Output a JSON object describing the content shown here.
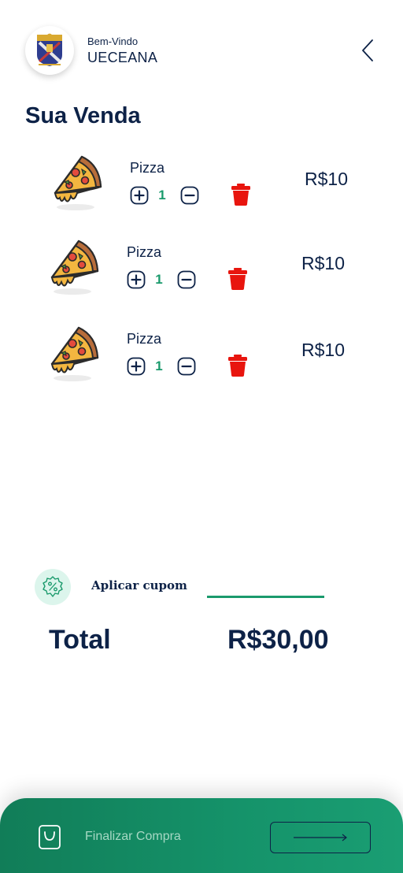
{
  "header": {
    "greeting": "Bem-Vindo",
    "user_name": "UECEANA",
    "logo_icon": "university-crest-icon",
    "back_icon": "chevron-left-icon"
  },
  "page_title": "Sua Venda",
  "cart": {
    "items": [
      {
        "name": "Pizza",
        "quantity": "1",
        "price": "R$10",
        "icon": "pizza-slice-icon"
      },
      {
        "name": "Pizza",
        "quantity": "1",
        "price": "R$10",
        "icon": "pizza-slice-icon"
      },
      {
        "name": "Pizza",
        "quantity": "1",
        "price": "R$10",
        "icon": "pizza-slice-icon"
      }
    ]
  },
  "coupon": {
    "label": "Aplicar cupom",
    "value": "",
    "icon": "percent-tag-icon"
  },
  "total": {
    "label": "Total",
    "value": "R$30,00"
  },
  "footer": {
    "checkout_label": "Finalizar Compra",
    "bag_icon": "shopping-bag-icon",
    "arrow_icon": "arrow-right-icon"
  },
  "colors": {
    "navy": "#0d2247",
    "green": "#1a9a6c",
    "trash_red": "#e8150e",
    "footer_gradient_start": "#117d58",
    "footer_gradient_end": "#1a9e73"
  }
}
